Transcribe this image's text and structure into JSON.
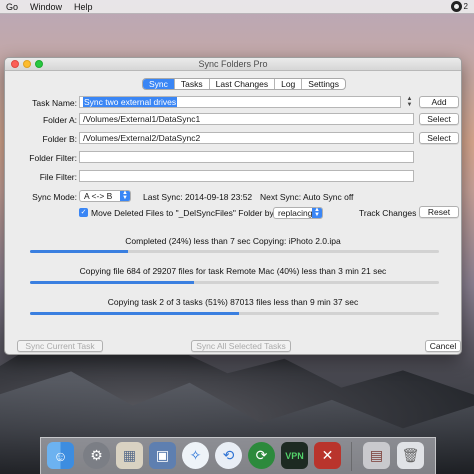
{
  "menubar": {
    "items": [
      "Go",
      "Window",
      "Help"
    ],
    "status_badge": "2"
  },
  "window": {
    "title": "Sync Folders Pro",
    "tabs": [
      {
        "label": "Sync",
        "active": true
      },
      {
        "label": "Tasks",
        "active": false
      },
      {
        "label": "Last Changes",
        "active": false
      },
      {
        "label": "Log",
        "active": false
      },
      {
        "label": "Settings",
        "active": false
      }
    ],
    "task_name_label": "Task Name:",
    "task_name_value": "Sync two external drives",
    "add_label": "Add",
    "folder_a_label": "Folder A:",
    "folder_a_value": "/Volumes/External1/DataSync1",
    "folder_b_label": "Folder B:",
    "folder_b_value": "/Volumes/External2/DataSync2",
    "select_label": "Select",
    "folder_filter_label": "Folder Filter:",
    "file_filter_label": "File Filter:",
    "sync_mode_label": "Sync Mode:",
    "sync_mode_value": "A <-> B",
    "last_sync": "Last Sync: 2014-09-18 23:52",
    "next_sync": "Next Sync: Auto Sync off",
    "move_deleted_label": "Move Deleted Files to \"_DelSyncFiles\" Folder by:",
    "move_deleted_checked": true,
    "replacing_value": "replacing",
    "track_changes_label": "Track Changes",
    "reset_label": "Reset",
    "progress": [
      {
        "text": "Completed (24%) less than 7 sec Copying: iPhoto 2.0.ipa",
        "fraction": 0.24
      },
      {
        "text": "Copying file 684 of 29207 files for task Remote Mac (40%) less than 3 min 21 sec",
        "fraction": 0.4
      },
      {
        "text": "Copying task 2 of 3 tasks (51%) 87013 files less than 9 min 37 sec",
        "fraction": 0.51
      }
    ],
    "sync_current_label": "Sync Current Task",
    "sync_all_label": "Sync All Selected Tasks",
    "cancel_label": "Cancel"
  },
  "dock": {
    "icons": [
      "finder-icon",
      "system-preferences-icon",
      "preview-icon",
      "photos-icon",
      "safari-icon",
      "sync-folders-icon",
      "sync-arrows-icon",
      "vpn-icon",
      "crossover-icon",
      "photo-booth-icon",
      "trash-icon"
    ],
    "vpn_label": "VPN"
  },
  "colors": {
    "accent": "#3a86f5",
    "progress_fill": "#3a7fe0"
  }
}
